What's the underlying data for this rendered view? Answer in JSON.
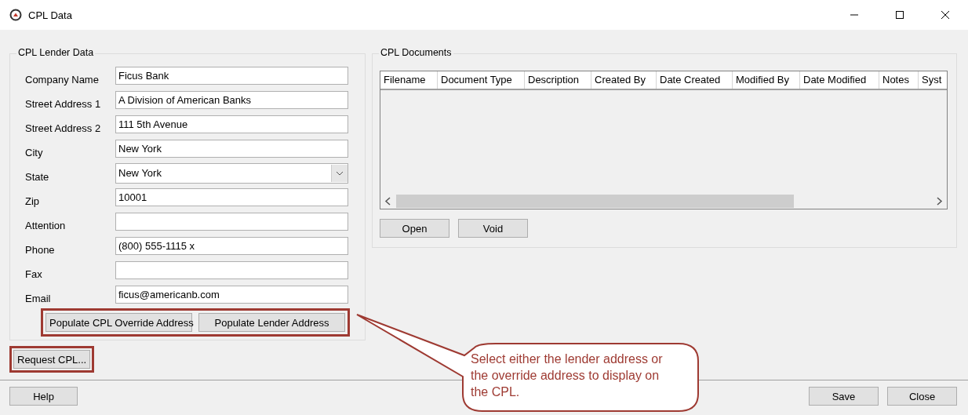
{
  "window": {
    "title": "CPL Data"
  },
  "lender": {
    "title": "CPL Lender Data",
    "fields": [
      {
        "label": "Company Name",
        "kind": "text",
        "value": "Ficus Bank"
      },
      {
        "label": "Street Address 1",
        "kind": "text",
        "value": "A Division of American Banks"
      },
      {
        "label": "Street Address 2",
        "kind": "text",
        "value": "111 5th Avenue"
      },
      {
        "label": "City",
        "kind": "text",
        "value": "New York"
      },
      {
        "label": "State",
        "kind": "select",
        "value": "New York"
      },
      {
        "label": "Zip",
        "kind": "text",
        "value": "10001"
      },
      {
        "label": "Attention",
        "kind": "text"
      },
      {
        "label": "Phone",
        "kind": "text",
        "value": "(800) 555-1115 x"
      },
      {
        "label": "Fax",
        "kind": "text"
      },
      {
        "label": "Email",
        "kind": "text",
        "value": "ficus@americanb.com"
      }
    ],
    "buttons": [
      "Populate CPL Override Address",
      "Populate Lender Address"
    ],
    "buttons_highlighted": true
  },
  "request_button": {
    "label": "Request CPL...",
    "highlighted": true
  },
  "documents": {
    "title": "CPL Documents",
    "columns": [
      "Filename",
      "Document Type",
      "Description",
      "Created By",
      "Date Created",
      "Modified By",
      "Date Modified",
      "Notes",
      "Syst"
    ],
    "buttons": [
      "Open",
      "Void"
    ]
  },
  "footer": {
    "left_buttons": [
      "Help"
    ],
    "right_buttons": [
      "Save",
      "Close"
    ]
  },
  "callout": {
    "text": "Select either the lender address or the override address to display on the CPL."
  }
}
